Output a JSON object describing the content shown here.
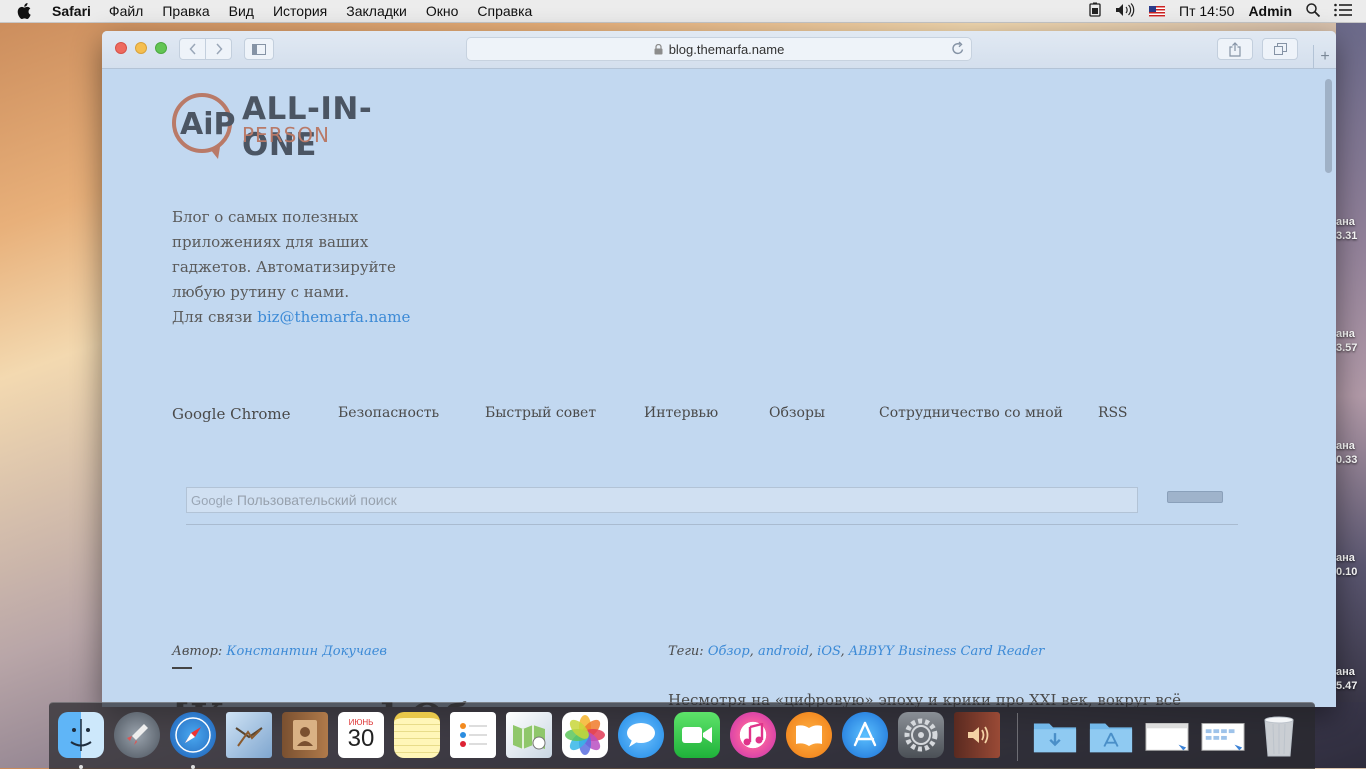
{
  "menubar": {
    "app": "Safari",
    "items": [
      "Файл",
      "Правка",
      "Вид",
      "История",
      "Закладки",
      "Окно",
      "Справка"
    ],
    "clock": "Пт 14:50",
    "user": "Admin"
  },
  "desktop_labels": [
    {
      "line1": "ана",
      "line2": "3.31"
    },
    {
      "line1": "ана",
      "line2": "3.57"
    },
    {
      "line1": "ана",
      "line2": "0.33"
    },
    {
      "line1": "ана",
      "line2": "0.10"
    },
    {
      "line1": "ана",
      "line2": "5.47"
    }
  ],
  "browser": {
    "address": "blog.themarfa.name"
  },
  "site": {
    "logo_line1": "ALL-IN-ONE",
    "logo_line2": "PERSON",
    "logo_mark": "AiP",
    "description": "Блог о самых полезных приложениях для ваших гаджетов. Автоматизируйте любую рутину с нами.",
    "contact_prefix": "Для связи",
    "contact_email": "biz@themarfa.name",
    "nav": [
      "Google Chrome",
      "Безопасность",
      "Быстрый совет",
      "Интервью",
      "Обзоры",
      "Сотрудничество со мной",
      "RSS"
    ],
    "search_brand": "Google",
    "search_placeholder": "Пользовательский поиск"
  },
  "post": {
    "author_label": "Автор:",
    "author": "Константин Докучаев",
    "tags_label": "Теги:",
    "tags": [
      "Обзор",
      "android",
      "iOS",
      "ABBYY Business Card Reader"
    ],
    "title": "[Конкурс] Обзор",
    "excerpt": "Несмотря на «цифровую» эпоху и крики про XXI век, вокруг всё равно полно людей, которые застряли в прошлом. Это же касается и деловых"
  },
  "dock": {
    "calendar_month": "ИЮНЬ",
    "calendar_day": "30"
  },
  "colors": {
    "page_bg": "#c2d8f0",
    "link": "#3c8ad6",
    "logo_dark": "#4b5563",
    "logo_accent": "#b97a68"
  }
}
